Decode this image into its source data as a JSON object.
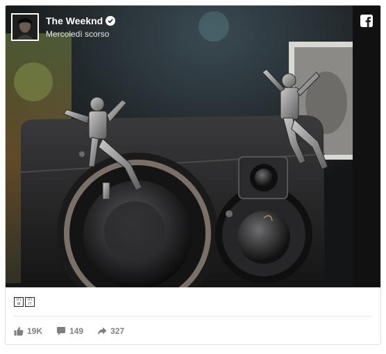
{
  "post": {
    "author": "The Weeknd",
    "verified": true,
    "timestamp": "Mercoledì scorso",
    "caption_emoji": [
      "🇫🇷",
      "🇫🇷"
    ],
    "caption_glyphs": [
      [
        "1F1",
        "EB"
      ],
      [
        "1F1",
        "F7"
      ]
    ]
  },
  "stats": {
    "likes": "19K",
    "comments": "149",
    "shares": "327"
  },
  "icons": {
    "brand": "facebook-icon",
    "verified": "verified-check-icon",
    "like": "thumbs-up-icon",
    "comment": "comment-bubble-icon",
    "share": "share-arrow-icon"
  },
  "colors": {
    "brand": "#3b5998",
    "muted_text": "#7f7f7f",
    "border": "#dddfe2"
  }
}
